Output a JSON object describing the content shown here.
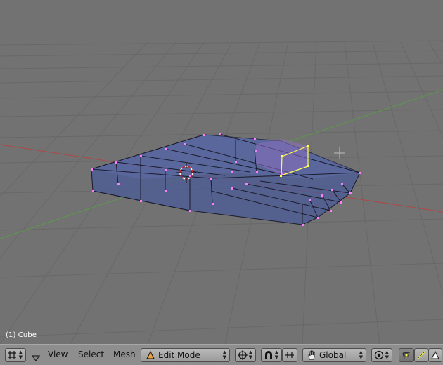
{
  "viewport": {
    "object_label": "(1) Cube",
    "colors": {
      "background": "#727272",
      "grid": "#6a6a6a",
      "x_axis": "#b34545",
      "y_axis": "#5a9a4a",
      "mesh_fill": "#4a5a95",
      "mesh_edge": "#1c1c2c",
      "vertex": "#ff7bff",
      "selected": "#ffff55"
    }
  },
  "header": {
    "editor_icon": "grid-icon",
    "menus": [
      "View",
      "Select",
      "Mesh"
    ],
    "mode": {
      "label": "Edit Mode",
      "icon": "mode-triangle-icon"
    },
    "pivot_icon": "pivot-icon",
    "magnet_icon": "magnet-icon",
    "snap_icon": "snap-icon",
    "transform_orientation": {
      "label": "Global",
      "icon": "hand-icon"
    },
    "proportional_icon": "proportional-icon",
    "select_modes": [
      "vertex-select-icon",
      "edge-select-icon",
      "face-select-icon"
    ]
  }
}
